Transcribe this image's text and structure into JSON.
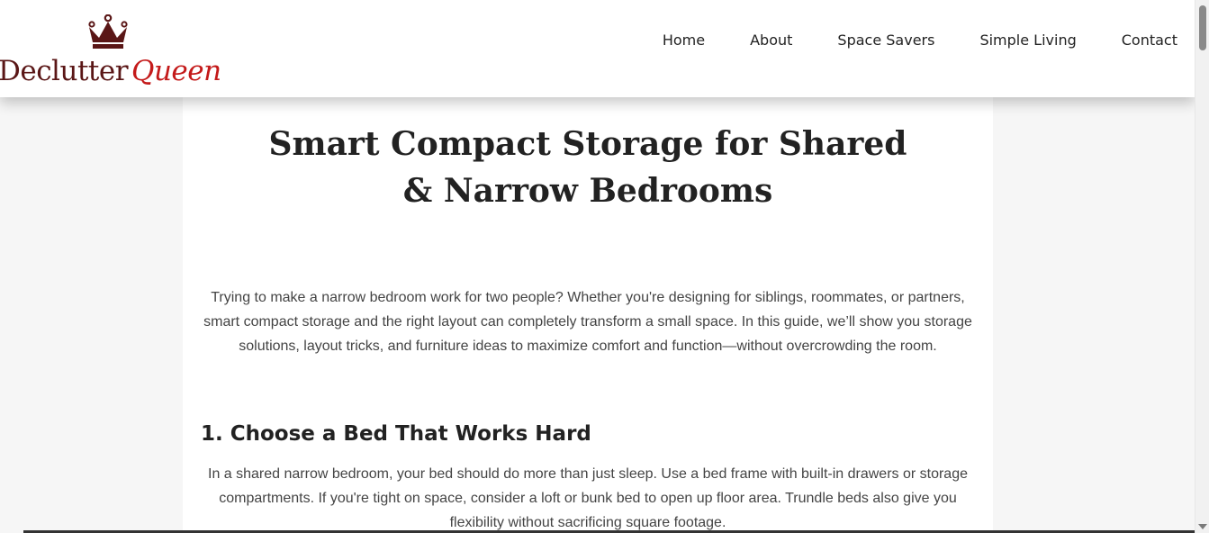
{
  "brand": {
    "name_part1": "Declutter",
    "name_part2": "Queen",
    "icon": "crown-icon",
    "colors": {
      "dark": "#5a1616",
      "accent": "#c41a1a"
    }
  },
  "nav": {
    "items": [
      {
        "label": "Home"
      },
      {
        "label": "About"
      },
      {
        "label": "Space Savers"
      },
      {
        "label": "Simple Living"
      },
      {
        "label": "Contact"
      }
    ]
  },
  "article": {
    "title": "Smart Compact Storage for Shared & Narrow Bedrooms",
    "intro": "Trying to make a narrow bedroom work for two people? Whether you're designing for siblings, roommates, or partners, smart compact storage and the right layout can completely transform a small space. In this guide, we’ll show you storage solutions, layout tricks, and furniture ideas to maximize comfort and function—without overcrowding the room.",
    "sections": [
      {
        "heading": "1. Choose a Bed That Works Hard",
        "body": "In a shared narrow bedroom, your bed should do more than just sleep. Use a bed frame with built-in drawers or storage compartments. If you're tight on space, consider a loft or bunk bed to open up floor area. Trundle beds also give you flexibility without sacrificing square footage."
      }
    ]
  }
}
